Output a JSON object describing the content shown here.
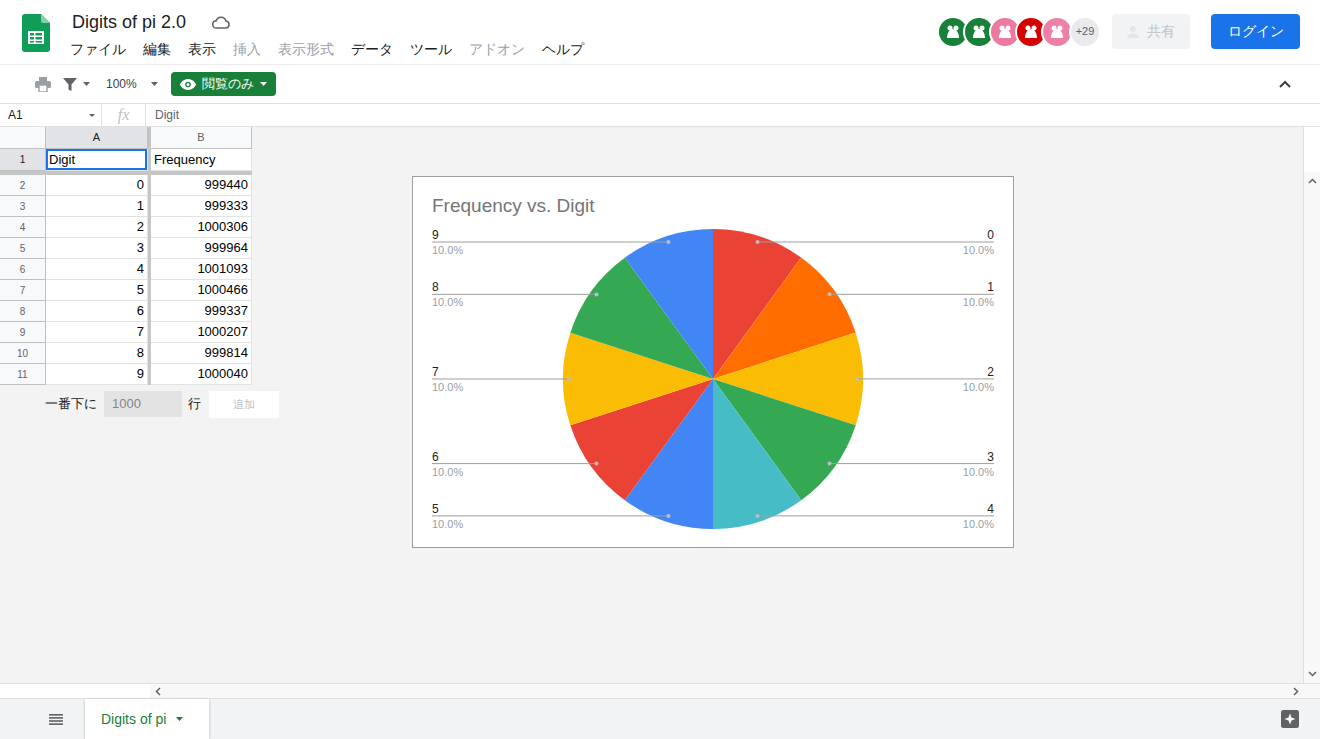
{
  "app": {
    "title": "Digits of pi 2.0"
  },
  "menus": [
    {
      "label": "ファイル",
      "disabled": false
    },
    {
      "label": "編集",
      "disabled": false
    },
    {
      "label": "表示",
      "disabled": false
    },
    {
      "label": "挿入",
      "disabled": true
    },
    {
      "label": "表示形式",
      "disabled": true
    },
    {
      "label": "データ",
      "disabled": false
    },
    {
      "label": "ツール",
      "disabled": false
    },
    {
      "label": "アドオン",
      "disabled": true
    },
    {
      "label": "ヘルプ",
      "disabled": false
    }
  ],
  "collaborators": {
    "avatars": [
      {
        "color": "#188038"
      },
      {
        "color": "#188038"
      },
      {
        "color": "#ec7a9f"
      },
      {
        "color": "#d50000"
      },
      {
        "color": "#ef7fa6"
      }
    ],
    "more": "+29"
  },
  "share_button": {
    "label": "共有",
    "disabled": true
  },
  "login_button": {
    "label": "ログイン"
  },
  "toolbar": {
    "zoom": "100%",
    "mode": "閲覧のみ"
  },
  "formula_bar": {
    "cell": "A1",
    "fx": "fx",
    "value": "Digit"
  },
  "sheet": {
    "columns": [
      {
        "label": "A",
        "selected": true
      },
      {
        "label": "B",
        "selected": false
      }
    ],
    "rows": [
      {
        "number": "1",
        "selected": true,
        "cells": [
          {
            "text": "Digit",
            "selected": true
          },
          {
            "text": "Frequency",
            "selected": false
          }
        ]
      },
      {
        "number": "2",
        "selected": false,
        "cells": [
          {
            "text": "0",
            "selected": false
          },
          {
            "text": "999440",
            "selected": false
          }
        ]
      },
      {
        "number": "3",
        "selected": false,
        "cells": [
          {
            "text": "1",
            "selected": false
          },
          {
            "text": "999333",
            "selected": false
          }
        ]
      },
      {
        "number": "4",
        "selected": false,
        "cells": [
          {
            "text": "2",
            "selected": false
          },
          {
            "text": "1000306",
            "selected": false
          }
        ]
      },
      {
        "number": "5",
        "selected": false,
        "cells": [
          {
            "text": "3",
            "selected": false
          },
          {
            "text": "999964",
            "selected": false
          }
        ]
      },
      {
        "number": "6",
        "selected": false,
        "cells": [
          {
            "text": "4",
            "selected": false
          },
          {
            "text": "1001093",
            "selected": false
          }
        ]
      },
      {
        "number": "7",
        "selected": false,
        "cells": [
          {
            "text": "5",
            "selected": false
          },
          {
            "text": "1000466",
            "selected": false
          }
        ]
      },
      {
        "number": "8",
        "selected": false,
        "cells": [
          {
            "text": "6",
            "selected": false
          },
          {
            "text": "999337",
            "selected": false
          }
        ]
      },
      {
        "number": "9",
        "selected": false,
        "cells": [
          {
            "text": "7",
            "selected": false
          },
          {
            "text": "1000207",
            "selected": false
          }
        ]
      },
      {
        "number": "10",
        "selected": false,
        "cells": [
          {
            "text": "8",
            "selected": false
          },
          {
            "text": "999814",
            "selected": false
          }
        ]
      },
      {
        "number": "11",
        "selected": false,
        "cells": [
          {
            "text": "9",
            "selected": false
          },
          {
            "text": "1000040",
            "selected": false
          }
        ]
      }
    ]
  },
  "add_rows": {
    "prefix": "一番下に",
    "count": "1000",
    "suffix": "行",
    "button": "追加",
    "disabled": true
  },
  "chart": {
    "title": "Frequency vs. Digit",
    "slices": [
      {
        "label": "0",
        "value": 999440,
        "percent": "10.0%",
        "color": "#ea4335"
      },
      {
        "label": "1",
        "value": 999333,
        "percent": "10.0%",
        "color": "#ff6d01"
      },
      {
        "label": "2",
        "value": 1000306,
        "percent": "10.0%",
        "color": "#fbbc04"
      },
      {
        "label": "3",
        "value": 999964,
        "percent": "10.0%",
        "color": "#34a853"
      },
      {
        "label": "4",
        "value": 1001093,
        "percent": "10.0%",
        "color": "#46bdc6"
      },
      {
        "label": "5",
        "value": 1000466,
        "percent": "10.0%",
        "color": "#4285f4"
      },
      {
        "label": "6",
        "value": 999337,
        "percent": "10.0%",
        "color": "#ea4335"
      },
      {
        "label": "7",
        "value": 1000207,
        "percent": "10.0%",
        "color": "#fbbc04"
      },
      {
        "label": "8",
        "value": 999814,
        "percent": "10.0%",
        "color": "#34a853"
      },
      {
        "label": "9",
        "value": 1000040,
        "percent": "10.0%",
        "color": "#4285f4"
      }
    ]
  },
  "sheet_tabs": [
    {
      "label": "Digits of pi",
      "selected": true
    }
  ]
}
